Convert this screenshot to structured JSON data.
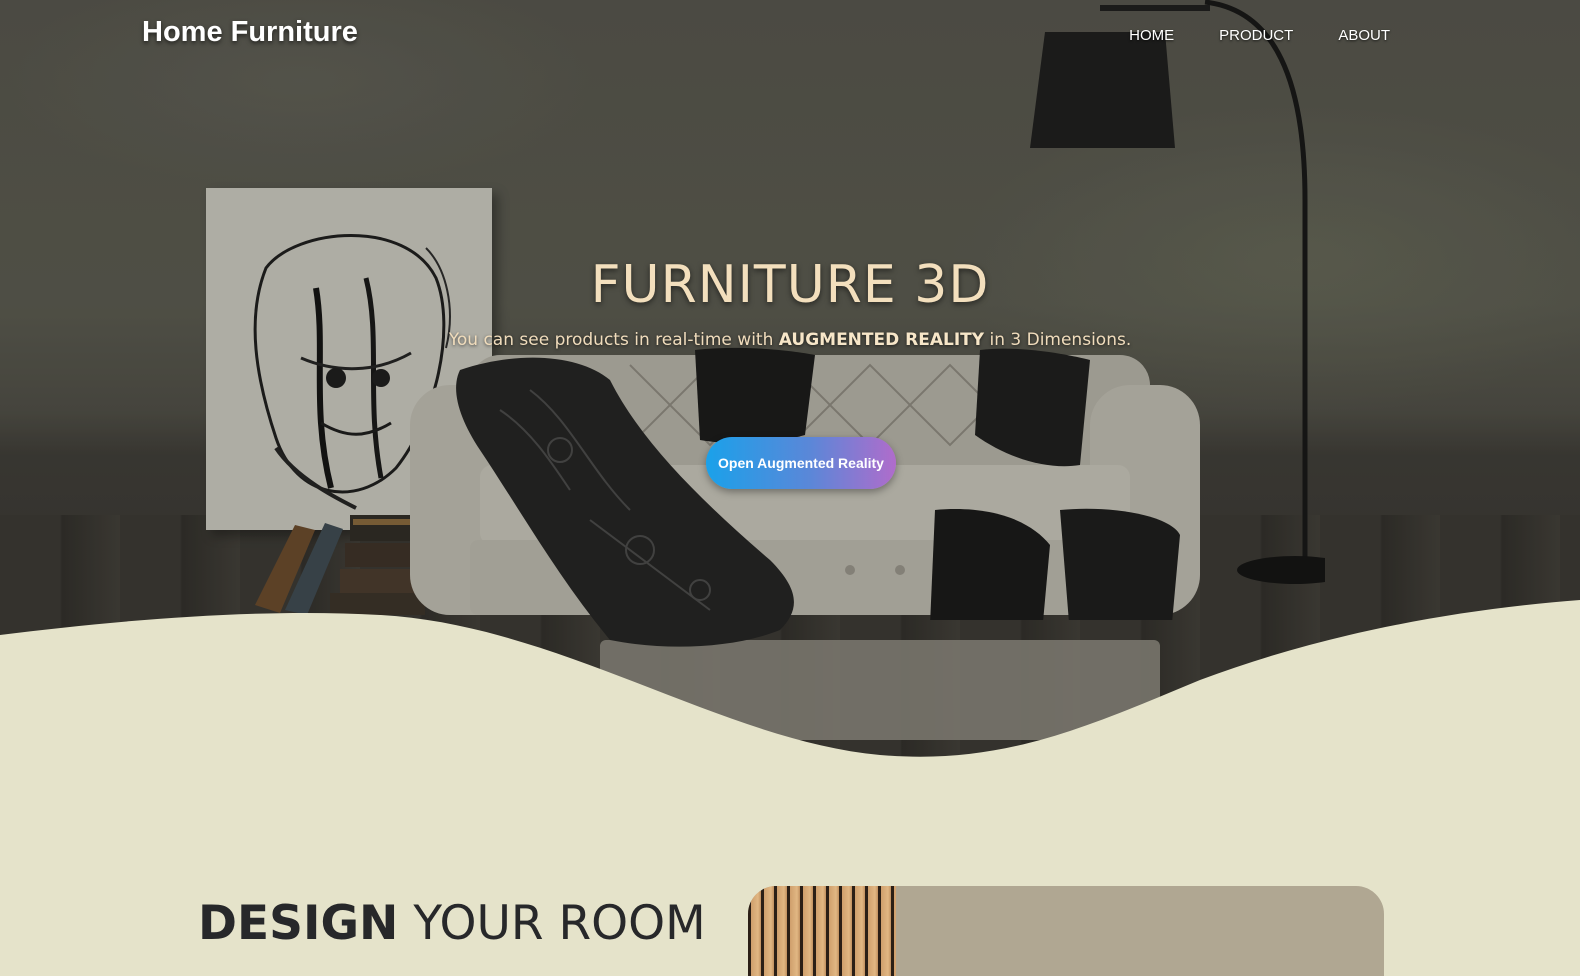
{
  "header": {
    "brand": "Home Furniture",
    "nav": [
      {
        "label": "HOME"
      },
      {
        "label": "PRODUCT"
      },
      {
        "label": "ABOUT"
      }
    ]
  },
  "hero": {
    "title": "FURNITURE 3D",
    "subtitle_before": "You can see products in real-time with ",
    "subtitle_emphasis": "AUGMENTED REALITY",
    "subtitle_after": " in 3 Dimensions.",
    "cta_label": "Open Augmented Reality"
  },
  "design_section": {
    "title_bold": "DESIGN",
    "title_rest": " YOUR ROOM"
  },
  "colors": {
    "section_background": "#e5e3ca",
    "hero_title": "#f3dfbd",
    "button_gradient_start": "#1aa1ea",
    "button_gradient_end": "#b06ccb",
    "heading_dark": "#27282a"
  }
}
